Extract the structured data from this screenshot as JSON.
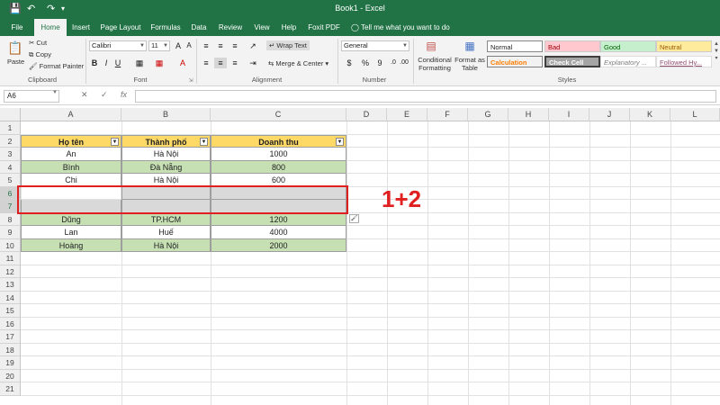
{
  "titlebar": {
    "title": "Book1 - Excel",
    "save_icon": "save-icon",
    "undo_icon": "undo-icon",
    "redo_icon": "redo-icon"
  },
  "tabs": [
    "File",
    "Home",
    "Insert",
    "Page Layout",
    "Formulas",
    "Data",
    "Review",
    "View",
    "Help",
    "Foxit PDF"
  ],
  "active_tab": "Home",
  "tell_me": "Tell me what you want to do",
  "ribbon": {
    "clipboard": {
      "paste": "Paste",
      "cut": "Cut",
      "copy": "Copy",
      "format_painter": "Format Painter",
      "label": "Clipboard"
    },
    "font": {
      "name": "Calibri",
      "size": "11",
      "bold": "B",
      "italic": "I",
      "underline": "U",
      "label": "Font"
    },
    "alignment": {
      "wrap_text": "Wrap Text",
      "merge_center": "Merge & Center",
      "label": "Alignment"
    },
    "number": {
      "format": "General",
      "label": "Number",
      "currency": "$",
      "percent": "%",
      "comma": "9"
    },
    "styles": {
      "conditional": "Conditional Formatting",
      "cond_line1": "Conditional",
      "cond_line2": "Formatting",
      "format_table_line1": "Format as",
      "format_table_line2": "Table",
      "normal": "Normal",
      "bad": "Bad",
      "good": "Good",
      "neutral": "Neutral",
      "calculation": "Calculation",
      "check_cell": "Check Cell",
      "explanatory": "Explanatory ...",
      "followed": "Followed Hy...",
      "label": "Styles"
    }
  },
  "formula_bar": {
    "name_box": "A6",
    "fx": "fx",
    "cancel": "✕",
    "enter": "✓",
    "value": ""
  },
  "columns": [
    "A",
    "B",
    "C",
    "D",
    "E",
    "F",
    "G",
    "H",
    "I",
    "J",
    "K",
    "L"
  ],
  "rows": [
    "1",
    "2",
    "3",
    "4",
    "5",
    "6",
    "7",
    "8",
    "9",
    "10",
    "11",
    "12",
    "13",
    "14",
    "15",
    "16",
    "17",
    "18",
    "19",
    "20",
    "21"
  ],
  "table": {
    "headers": [
      "Họ tên",
      "Thành phố",
      "Doanh thu"
    ],
    "rows": [
      [
        "An",
        "Hà Nội",
        "1000"
      ],
      [
        "Bình",
        "Đà Nẵng",
        "800"
      ],
      [
        "Chi",
        "Hà Nội",
        "600"
      ],
      [
        "",
        "",
        ""
      ],
      [
        "",
        "",
        ""
      ],
      [
        "Dũng",
        "TP.HCM",
        "1200"
      ],
      [
        "Lan",
        "Huế",
        "4000"
      ],
      [
        "Hoàng",
        "Hà Nội",
        "2000"
      ]
    ]
  },
  "annotation": "1+2",
  "colors": {
    "excel_green": "#217346",
    "header_fill": "#ffd966",
    "band_green": "#c6e0b4",
    "selected_gray": "#d9d9d9",
    "annotation_red": "#e02020"
  }
}
